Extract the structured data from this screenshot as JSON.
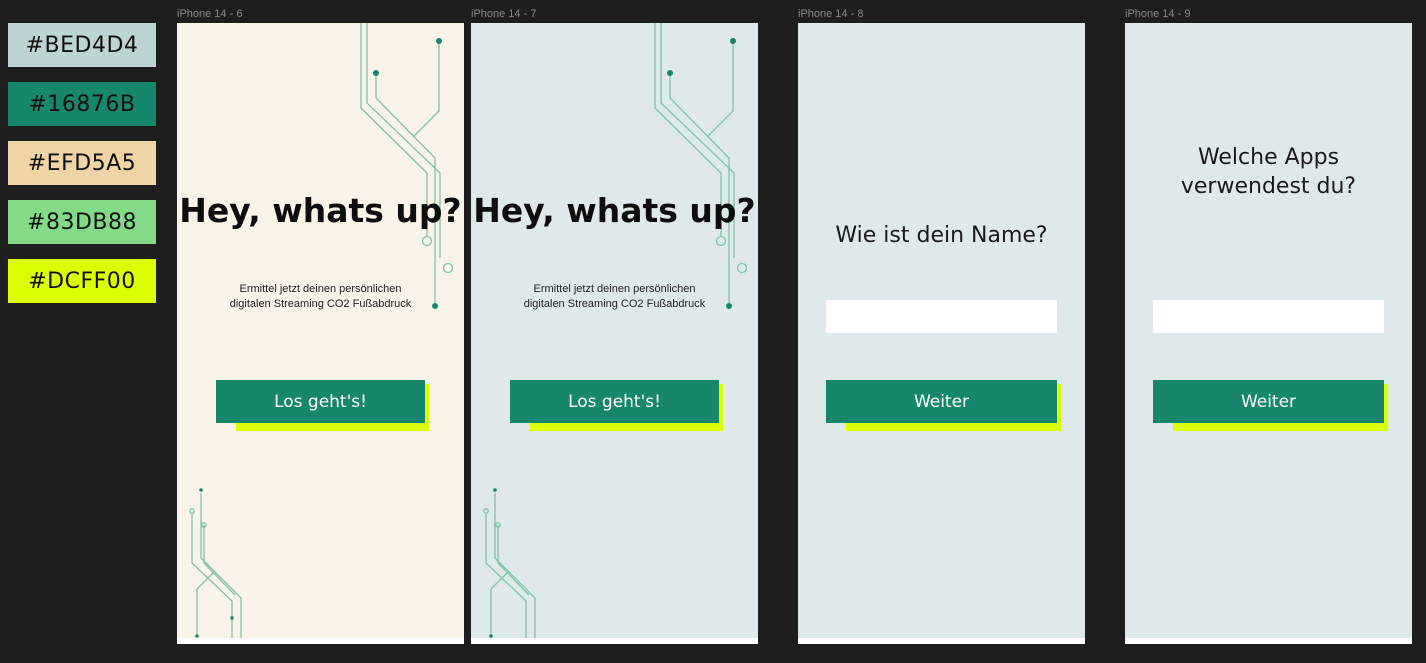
{
  "palette": [
    {
      "label": "#BED4D4",
      "color": "#BED4D4"
    },
    {
      "label": "#16876B",
      "color": "#16876B"
    },
    {
      "label": "#EFD5A5",
      "color": "#EFD5A5"
    },
    {
      "label": "#83DB88",
      "color": "#83DB88"
    },
    {
      "label": "#DCFF00",
      "color": "#DCFF00"
    }
  ],
  "frames": [
    {
      "label": "iPhone 14 - 6",
      "background": "#faf3e8",
      "headline": "Hey, whats up?",
      "subtext_line1": "Ermittel jetzt deinen persönlichen",
      "subtext_line2": "digitalen Streaming CO2 Fußabdruck",
      "button": "Los geht's!"
    },
    {
      "label": "iPhone 14 - 7",
      "background": "#e0e9e9",
      "headline": "Hey, whats up?",
      "subtext_line1": "Ermittel jetzt deinen persönlichen",
      "subtext_line2": "digitalen Streaming CO2 Fußabdruck",
      "button": "Los geht's!"
    },
    {
      "label": "iPhone 14 - 8",
      "background": "#e0e9e9",
      "question_line1": "Wie ist dein Name?",
      "input_value": "",
      "button": "Weiter"
    },
    {
      "label": "iPhone 14 - 9",
      "background": "#e0e9e9",
      "question_line1": "Welche Apps",
      "question_line2": "verwendest du?",
      "input_value": "",
      "button": "Weiter"
    }
  ],
  "colors": {
    "canvas": "#1e1e1e",
    "circuit_line": "#7ec4a6",
    "circuit_dot": "#16876b",
    "button": "#16876b",
    "button_shadow": "#dcff00"
  }
}
